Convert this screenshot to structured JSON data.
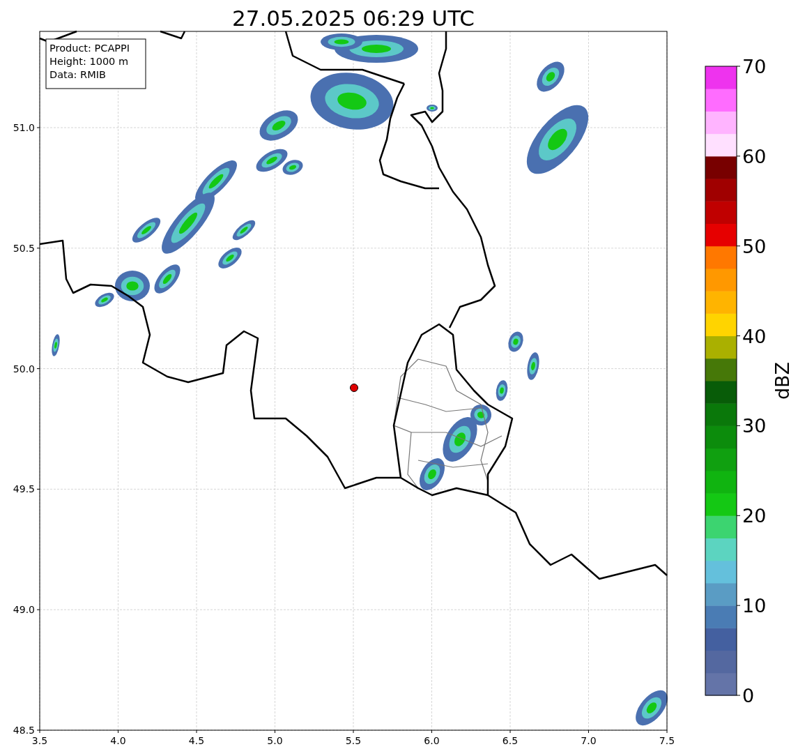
{
  "title": "27.05.2025 06:29 UTC",
  "map": {
    "info_box": [
      "Product: PCAPPI",
      "Height: 1000 m",
      "Data: RMIB"
    ],
    "x_ticks": [
      "3.5",
      "4.0",
      "4.5",
      "5.0",
      "5.5",
      "6.0",
      "6.5",
      "7.0",
      "7.5"
    ],
    "y_ticks": [
      "51.0",
      "50.5",
      "50.0",
      "49.5",
      "49.0",
      "48.5"
    ]
  },
  "colorbar": {
    "label": "dBZ",
    "ticks": [
      "70",
      "60",
      "50",
      "40",
      "30",
      "20",
      "10",
      "0"
    ],
    "bins": [
      {
        "color": "#6474a8"
      },
      {
        "color": "#5468a0"
      },
      {
        "color": "#4460a0"
      },
      {
        "color": "#4a7cb4"
      },
      {
        "color": "#5a9cc4"
      },
      {
        "color": "#64c0dc"
      },
      {
        "color": "#5cd4c0"
      },
      {
        "color": "#3cd470"
      },
      {
        "color": "#14c814"
      },
      {
        "color": "#10b410"
      },
      {
        "color": "#10a010"
      },
      {
        "color": "#0c8c0c"
      },
      {
        "color": "#0a780a"
      },
      {
        "color": "#085c08"
      },
      {
        "color": "#467808"
      },
      {
        "color": "#aab000"
      },
      {
        "color": "#ffd400"
      },
      {
        "color": "#ffb400"
      },
      {
        "color": "#ff9800"
      },
      {
        "color": "#ff7800"
      },
      {
        "color": "#e60000"
      },
      {
        "color": "#c00000"
      },
      {
        "color": "#a00000"
      },
      {
        "color": "#780000"
      },
      {
        "color": "#ffe0ff"
      },
      {
        "color": "#ffb4ff"
      },
      {
        "color": "#ff6cff"
      },
      {
        "color": "#ee33ee"
      }
    ]
  }
}
